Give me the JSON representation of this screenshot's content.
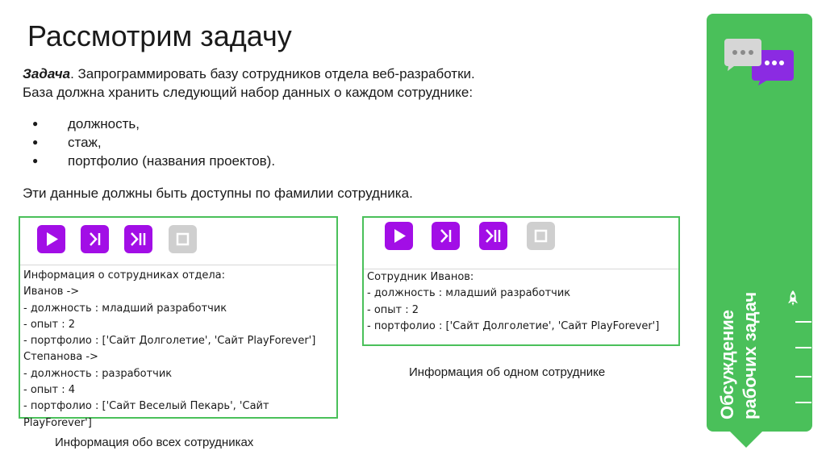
{
  "slide": {
    "title": "Рассмотрим задачу",
    "task_label": "Задача",
    "task_rest": ". Запрограммировать базу сотрудников отдела веб-разработки.",
    "task_line2": "База должна хранить  следующий набор данных о каждом сотруднике:",
    "bullets": [
      "должность,",
      "стаж,",
      "портфолио (названия проектов)."
    ],
    "availability": "Эти данные должны быть доступны по фамилии сотрудника."
  },
  "colors": {
    "accent_green": "#4ac05a",
    "button_purple": "#a20ee6",
    "button_disabled": "#cfcfcf"
  },
  "controls": {
    "icons": [
      "play-icon",
      "step-icon",
      "step-over-icon",
      "stop-icon"
    ]
  },
  "panel_all": {
    "lines": [
      "Информация о сотрудниках отдела:",
      "Иванов ->",
      "- должность : младший разработчик",
      "- опыт : 2",
      "- портфолио : ['Сайт Долголетие', 'Сайт PlayForever']",
      "Степанова ->",
      "- должность : разработчик",
      "- опыт : 4",
      "- портфолио : ['Сайт Веселый Пекарь', 'Сайт PlayForever']"
    ],
    "caption": "Информация обо всех сотрудниках"
  },
  "panel_one": {
    "lines": [
      "Сотрудник Иванов:",
      "- должность : младший разработчик",
      "- опыт : 2",
      "- портфолио : ['Сайт Долголетие', 'Сайт PlayForever']"
    ],
    "caption": "Информация об одном сотруднике"
  },
  "sidebar": {
    "label_line1": "Обсуждение",
    "label_line2": "рабочих задач",
    "icons": [
      "chat-bubbles-icon",
      "rocket-icon"
    ]
  }
}
